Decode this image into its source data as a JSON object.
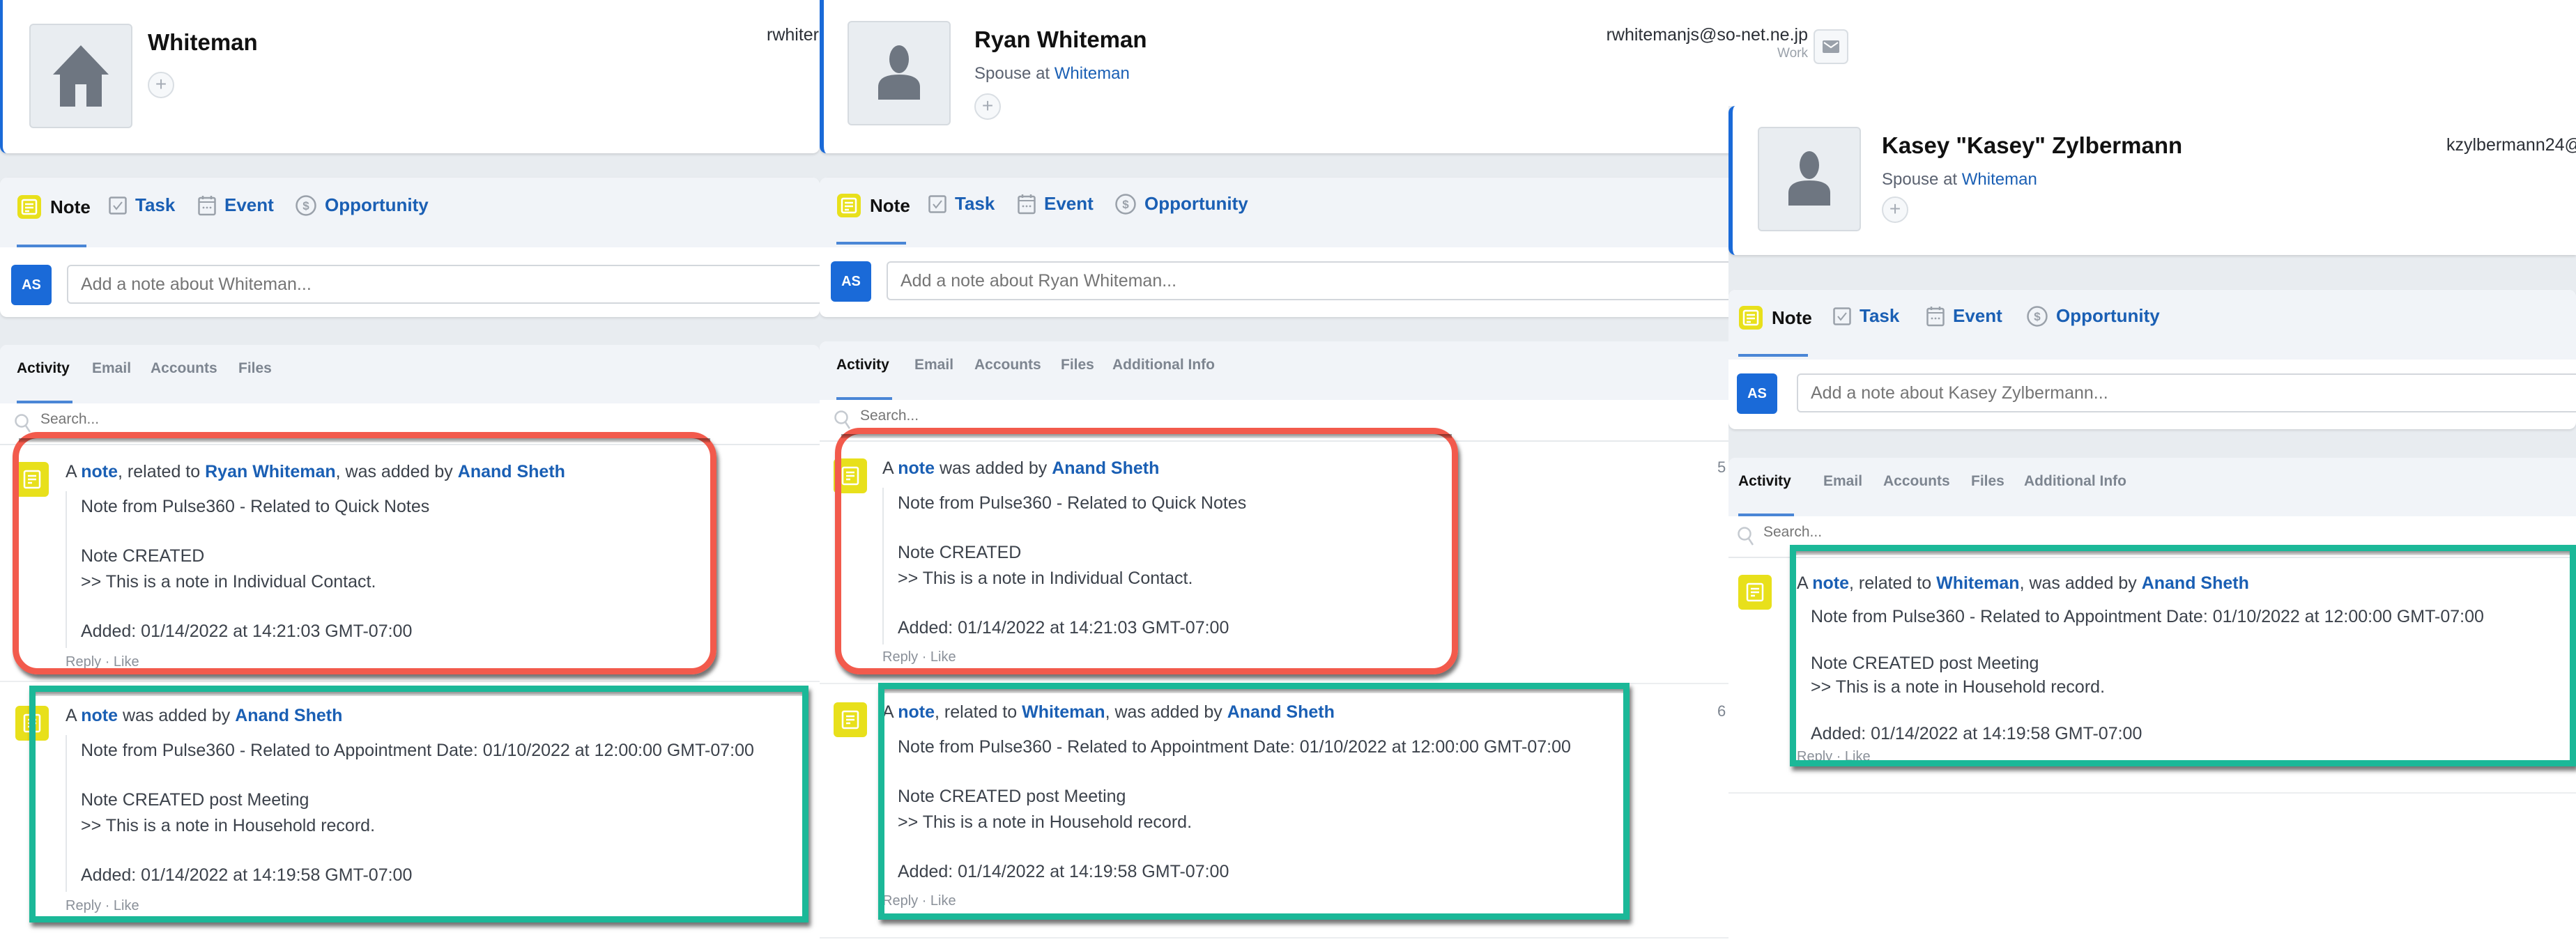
{
  "quick_actions": {
    "tabs": [
      {
        "label": "Note",
        "icon": "note-icon"
      },
      {
        "label": "Task",
        "icon": "checkbox-icon"
      },
      {
        "label": "Event",
        "icon": "calendar-icon"
      },
      {
        "label": "Opportunity",
        "icon": "dollar-circle-icon"
      }
    ],
    "user_initials": "AS"
  },
  "search_placeholder": "Search...",
  "reply_like": "Reply · Like",
  "panels": [
    {
      "record_name": "Whiteman",
      "avatar_icon": "house-icon",
      "email_partial": "rwhiter",
      "note_placeholder": "Add a note about Whiteman...",
      "activity_tabs": [
        "Activity",
        "Email",
        "Accounts",
        "Files"
      ],
      "entries": [
        {
          "head": {
            "prefix": "A ",
            "note": "note",
            "mid1": ", related to ",
            "related": "Ryan Whiteman",
            "mid2": ", was added by ",
            "author": "Anand Sheth"
          },
          "lines": [
            "Note from Pulse360 - Related to Quick Notes",
            "Note CREATED",
            ">> This is a note in Individual Contact.",
            "Added: 01/14/2022 at 14:21:03 GMT-07:00"
          ],
          "highlight": "red"
        },
        {
          "head": {
            "prefix": "A ",
            "note": "note",
            "mid1": " was added by ",
            "related": "",
            "mid2": "",
            "author": "Anand Sheth"
          },
          "lines": [
            "Note from Pulse360 - Related to Appointment Date: 01/10/2022 at 12:00:00 GMT-07:00",
            "Note CREATED post Meeting",
            ">> This is a note in Household record.",
            "Added: 01/14/2022 at 14:19:58 GMT-07:00"
          ],
          "highlight": "green"
        }
      ]
    },
    {
      "record_name": "Ryan Whiteman",
      "avatar_icon": "person-icon",
      "relationship": "Spouse at",
      "relationship_link": "Whiteman",
      "email": "rwhitemanjs@so-net.ne.jp",
      "email_type": "Work",
      "note_placeholder": "Add a note about Ryan Whiteman...",
      "activity_tabs": [
        "Activity",
        "Email",
        "Accounts",
        "Files",
        "Additional Info"
      ],
      "side_numbers": [
        "5",
        "6"
      ],
      "entries": [
        {
          "head": {
            "prefix": "A ",
            "note": "note",
            "mid1": " was added by ",
            "related": "",
            "mid2": "",
            "author": "Anand Sheth"
          },
          "lines": [
            "Note from Pulse360 - Related to Quick Notes",
            "Note CREATED",
            ">> This is a note in Individual Contact.",
            "Added: 01/14/2022 at 14:21:03 GMT-07:00"
          ],
          "highlight": "red"
        },
        {
          "head": {
            "prefix": "A ",
            "note": "note",
            "mid1": ", related to ",
            "related": "Whiteman",
            "mid2": ", was added by ",
            "author": "Anand Sheth"
          },
          "lines": [
            "Note from Pulse360 - Related to Appointment Date: 01/10/2022 at 12:00:00 GMT-07:00",
            "Note CREATED post Meeting",
            ">> This is a note in Household record.",
            "Added: 01/14/2022 at 14:19:58 GMT-07:00"
          ],
          "highlight": "green"
        }
      ]
    },
    {
      "record_name": "Kasey \"Kasey\" Zylbermann",
      "avatar_icon": "person-icon",
      "relationship": "Spouse at",
      "relationship_link": "Whiteman",
      "email_partial": "kzylbermann24@",
      "note_placeholder": "Add a note about Kasey Zylbermann...",
      "activity_tabs": [
        "Activity",
        "Email",
        "Accounts",
        "Files",
        "Additional Info"
      ],
      "entries": [
        {
          "head": {
            "prefix": "A ",
            "note": "note",
            "mid1": ", related to ",
            "related": "Whiteman",
            "mid2": ", was added by ",
            "author": "Anand Sheth"
          },
          "lines": [
            "Note from Pulse360 - Related to Appointment Date: 01/10/2022 at 12:00:00 GMT-07:00",
            "Note CREATED post Meeting",
            ">> This is a note in Household record.",
            "Added: 01/14/2022 at 14:19:58 GMT-07:00"
          ],
          "highlight": "green"
        }
      ]
    }
  ],
  "colors": {
    "accent_blue": "#1a6ad8",
    "link_blue": "#1a5fb4",
    "note_yellow": "#e8e01b",
    "highlight_red": "#f25a4c",
    "highlight_green": "#1bb898"
  }
}
